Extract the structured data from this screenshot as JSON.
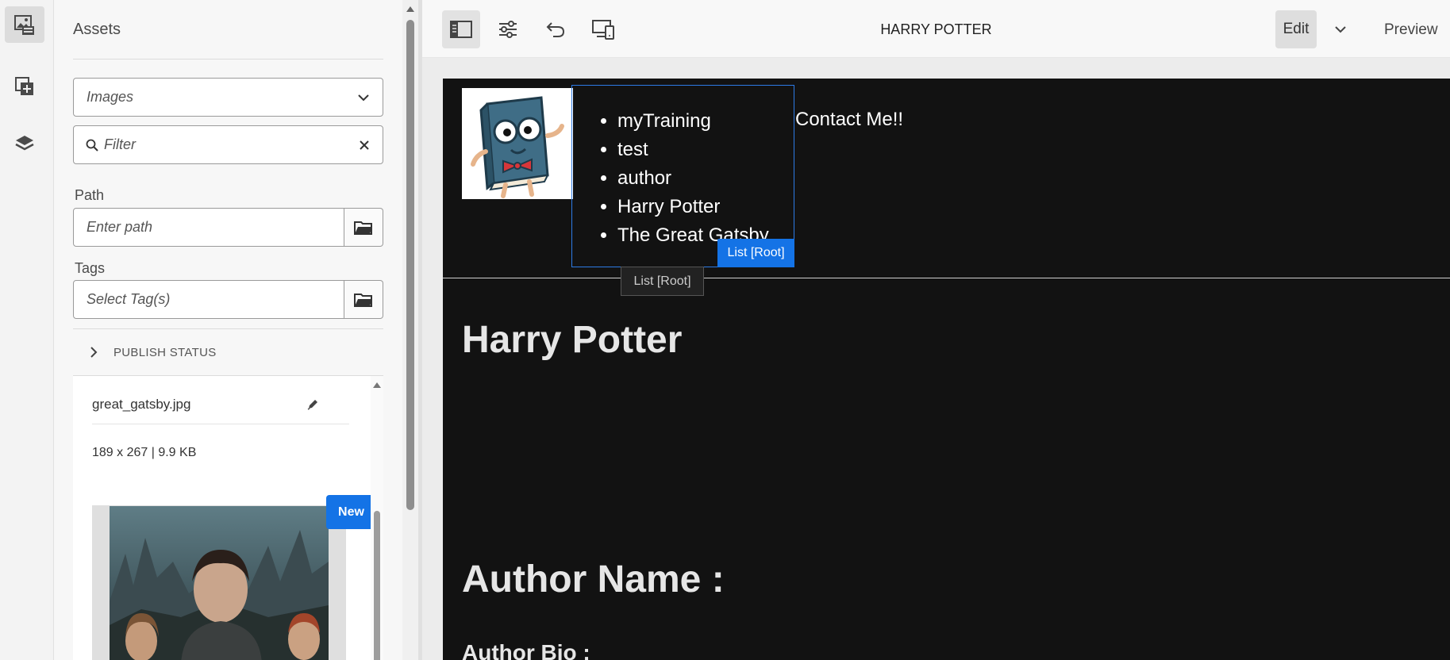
{
  "rail": {
    "items": [
      {
        "name": "assets-icon",
        "active": true
      },
      {
        "name": "components-icon",
        "active": false
      },
      {
        "name": "content-tree-icon",
        "active": false
      }
    ]
  },
  "assets_panel": {
    "title": "Assets",
    "type_select": {
      "value": "Images"
    },
    "filter": {
      "placeholder": "Filter"
    },
    "path": {
      "label": "Path",
      "placeholder": "Enter path"
    },
    "tags": {
      "label": "Tags",
      "placeholder": "Select Tag(s)"
    },
    "publish_status": {
      "label": "PUBLISH STATUS"
    },
    "asset": {
      "name": "great_gatsby.jpg",
      "meta": "189 x 267 | 9.9 KB",
      "badge": "New"
    }
  },
  "toolbar": {
    "page_title": "HARRY POTTER",
    "edit_label": "Edit",
    "preview_label": "Preview"
  },
  "page": {
    "nav_items": [
      "myTraining",
      "test",
      "author",
      "Harry Potter",
      "The Great Gatsby"
    ],
    "contact_label": "Contact Me!!",
    "component_badge": "List [Root]",
    "component_tooltip": "List [Root]",
    "heading": "Harry Potter",
    "author_name_label": "Author Name :",
    "author_bio_label": "Author Bio :"
  },
  "colors": {
    "accent": "#1473e6",
    "page_bg": "#121212"
  }
}
